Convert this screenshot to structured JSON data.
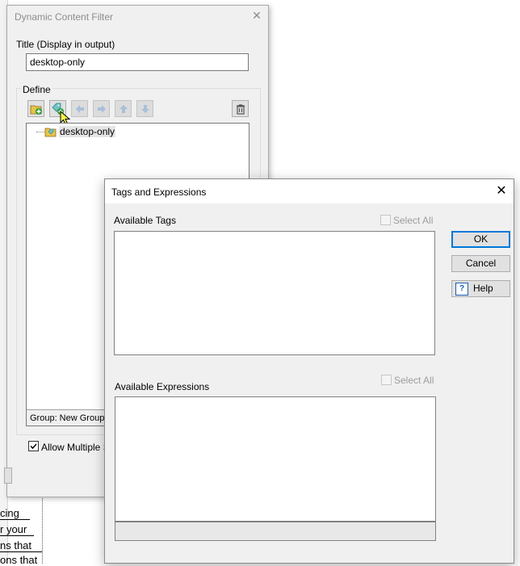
{
  "background": {
    "doc_fragments": [
      "cing",
      "r your",
      "ns that",
      "ons that"
    ]
  },
  "dcf": {
    "title": "Dynamic Content Filter",
    "close_glyph": "✕",
    "title_label": "Title (Display in output)",
    "title_value": "desktop-only",
    "define_label": "Define",
    "tree": [
      {
        "label": "desktop-only",
        "icon": "tag-icon"
      }
    ],
    "status": "Group: New Group",
    "allow_multiple_label": "Allow Multiple Se",
    "allow_multiple_checked": true
  },
  "tae": {
    "title": "Tags and Expressions",
    "close_glyph": "✕",
    "available_tags_label": "Available Tags",
    "select_all_tags_label": "Select All",
    "available_expressions_label": "Available Expressions",
    "select_all_expr_label": "Select All",
    "ok_label": "OK",
    "cancel_label": "Cancel",
    "help_label": "Help",
    "help_glyph": "?"
  },
  "colors": {
    "accent": "#0078d7",
    "window_bg": "#f0f0f0",
    "disabled_text": "#9d9d9d"
  }
}
